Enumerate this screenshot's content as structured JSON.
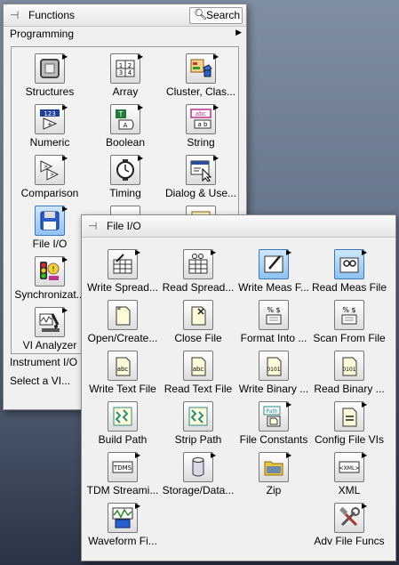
{
  "functions": {
    "title": "Functions",
    "search_label": "Search",
    "category": "Programming",
    "items": [
      {
        "label": "Structures",
        "icon": "structures-icon"
      },
      {
        "label": "Array",
        "icon": "array-icon"
      },
      {
        "label": "Cluster, Clas...",
        "icon": "cluster-class-icon"
      },
      {
        "label": "Numeric",
        "icon": "numeric-icon"
      },
      {
        "label": "Boolean",
        "icon": "boolean-icon"
      },
      {
        "label": "String",
        "icon": "string-icon"
      },
      {
        "label": "Comparison",
        "icon": "comparison-icon"
      },
      {
        "label": "Timing",
        "icon": "timing-icon"
      },
      {
        "label": "Dialog & Use...",
        "icon": "dialog-icon"
      },
      {
        "label": "File I/O",
        "icon": "file-io-icon"
      },
      {
        "label": "Synchronizat...",
        "icon": "synchronization-icon"
      },
      {
        "label": "VI Analyzer",
        "icon": "vi-analyzer-icon"
      }
    ],
    "text_items": [
      "Instrument I/O",
      "Select a VI..."
    ]
  },
  "fileio": {
    "title": "File I/O",
    "items": [
      {
        "label": "Write Spread...",
        "icon": "write-spreadsheet-icon"
      },
      {
        "label": "Read Spread...",
        "icon": "read-spreadsheet-icon"
      },
      {
        "label": "Write Meas F...",
        "icon": "write-meas-file-icon"
      },
      {
        "label": "Read Meas File",
        "icon": "read-meas-file-icon"
      },
      {
        "label": "Open/Create...",
        "icon": "open-create-icon"
      },
      {
        "label": "Close File",
        "icon": "close-file-icon"
      },
      {
        "label": "Format Into ...",
        "icon": "format-into-file-icon"
      },
      {
        "label": "Scan From File",
        "icon": "scan-from-file-icon"
      },
      {
        "label": "Write Text File",
        "icon": "write-text-file-icon"
      },
      {
        "label": "Read Text File",
        "icon": "read-text-file-icon"
      },
      {
        "label": "Write Binary ...",
        "icon": "write-binary-icon"
      },
      {
        "label": "Read Binary ...",
        "icon": "read-binary-icon"
      },
      {
        "label": "Build Path",
        "icon": "build-path-icon"
      },
      {
        "label": "Strip Path",
        "icon": "strip-path-icon"
      },
      {
        "label": "File Constants",
        "icon": "file-constants-icon"
      },
      {
        "label": "Config File VIs",
        "icon": "config-file-icon"
      },
      {
        "label": "TDM Streami...",
        "icon": "tdm-streaming-icon"
      },
      {
        "label": "Storage/Data...",
        "icon": "storage-icon"
      },
      {
        "label": "Zip",
        "icon": "zip-icon"
      },
      {
        "label": "XML",
        "icon": "xml-icon"
      },
      {
        "label": "Waveform Fi...",
        "icon": "waveform-file-icon"
      },
      {
        "label": "",
        "icon": ""
      },
      {
        "label": "",
        "icon": ""
      },
      {
        "label": "Adv File Funcs",
        "icon": "adv-file-funcs-icon"
      }
    ]
  },
  "icon_text": {
    "array": [
      "1",
      "2",
      "3",
      "4"
    ],
    "boolean_t": "T",
    "boolean_a": "A",
    "string_top": "abc",
    "string_bottom": "a b",
    "numeric": "123",
    "path": "Path",
    "tdms": "TDMS",
    "xml": "<XML>",
    "binary": "0101",
    "text": "abc",
    "format": "% $"
  },
  "colors": {
    "selection": "#3a78c2",
    "numeric_blue": "#1f3f9a",
    "boolean_green": "#1f7a3a",
    "string_pink": "#c0308f",
    "path_teal": "#2b8a8a",
    "zip_yellow": "#e9c53a"
  }
}
